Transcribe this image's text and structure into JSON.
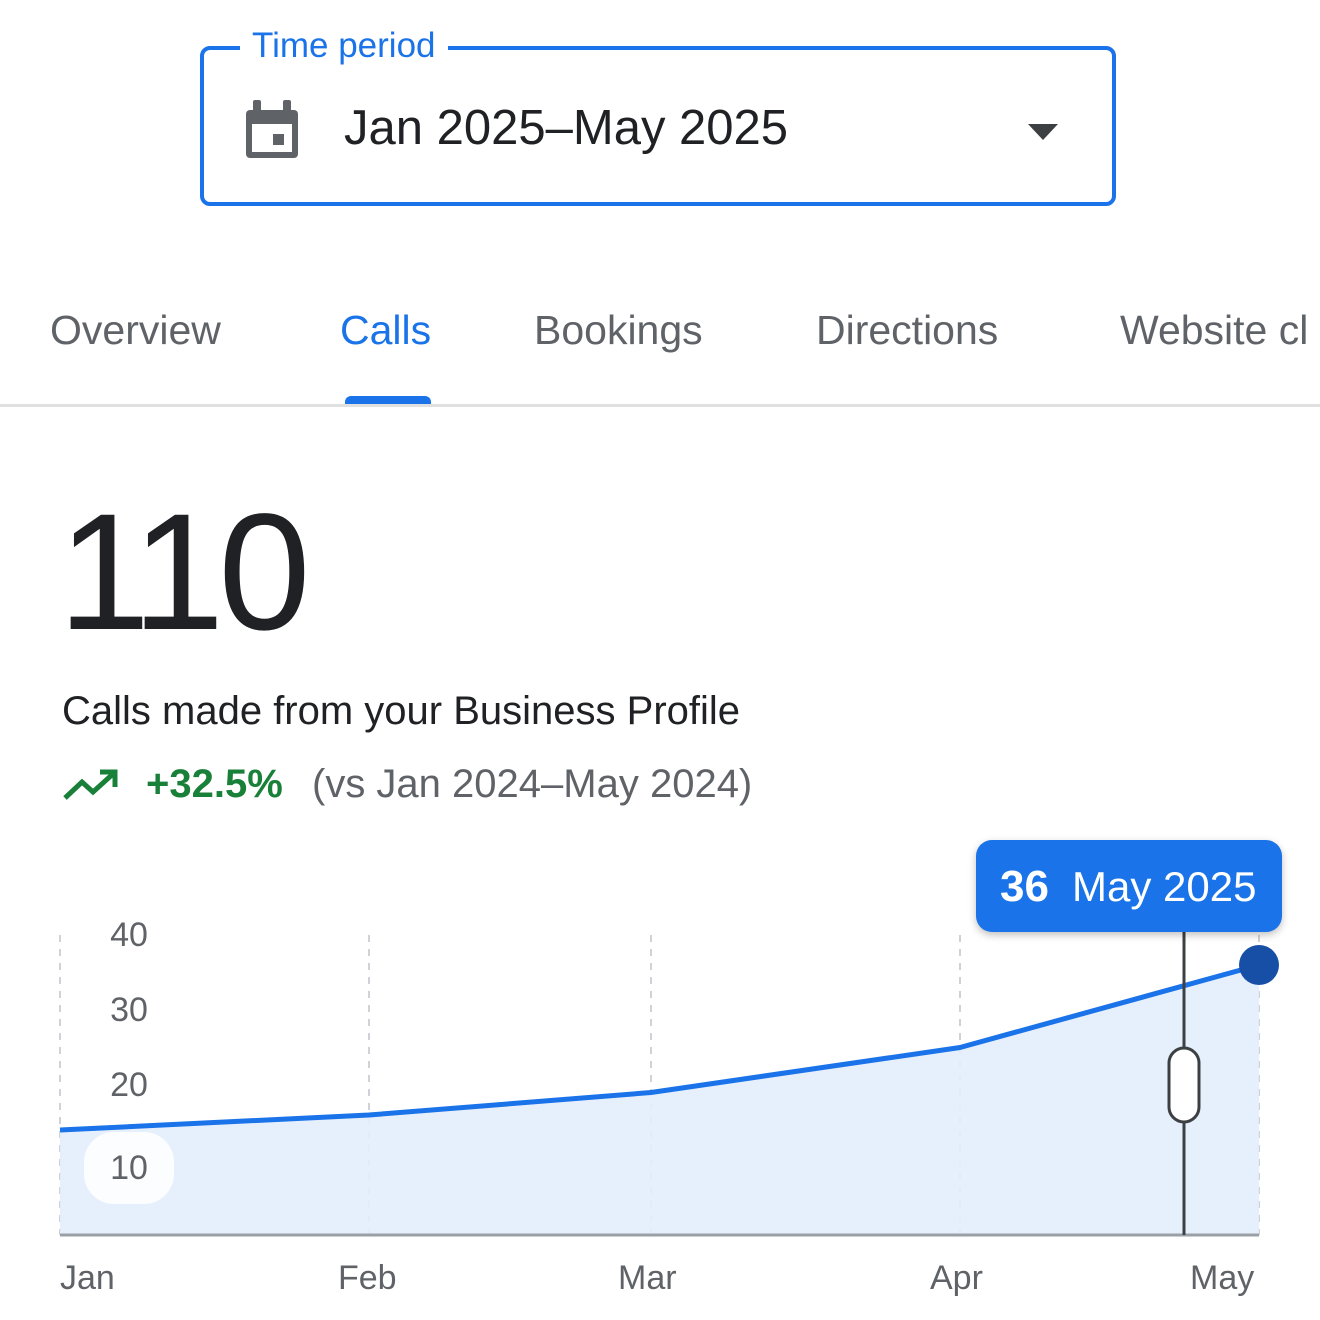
{
  "time_period": {
    "label": "Time period",
    "value": "Jan 2025–May 2025"
  },
  "tabs": [
    {
      "label": "Overview",
      "active": false
    },
    {
      "label": "Calls",
      "active": true
    },
    {
      "label": "Bookings",
      "active": false
    },
    {
      "label": "Directions",
      "active": false
    },
    {
      "label": "Website cl",
      "active": false
    }
  ],
  "summary": {
    "total": "110",
    "label": "Calls made from your Business Profile",
    "change": "+32.5%",
    "comparison": "(vs Jan 2024–May 2024)"
  },
  "tooltip": {
    "value": "36",
    "date": "May 2025"
  },
  "colors": {
    "accent": "#1a73e8",
    "positive": "#188038",
    "area_fill": "#e3edfc",
    "point": "#174ea6"
  },
  "icons": {
    "period": "calendar-icon",
    "dropdown": "arrow-drop-down-icon",
    "trend": "trending-up-icon"
  },
  "chart_data": {
    "type": "area",
    "categories": [
      "Jan",
      "Feb",
      "Mar",
      "Apr",
      "May"
    ],
    "values": [
      14,
      16,
      19,
      25,
      36
    ],
    "yticks": [
      "40",
      "30",
      "20",
      "10"
    ],
    "ylim": [
      0,
      40
    ],
    "grid": "vertical dashed",
    "highlighted_point": {
      "category": "May",
      "value": 36
    }
  }
}
